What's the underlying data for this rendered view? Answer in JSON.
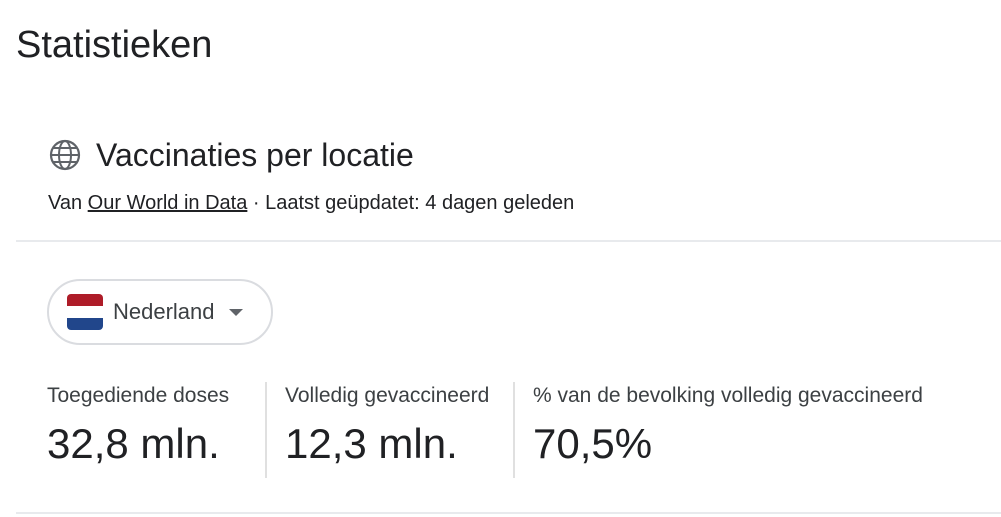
{
  "page": {
    "title": "Statistieken"
  },
  "card": {
    "title": "Vaccinaties per locatie",
    "icon": "globe-icon",
    "source": {
      "prefix": "Van ",
      "link_text": "Our World in Data",
      "suffix": " · Laatst geüpdatet: 4 dagen geleden"
    }
  },
  "location": {
    "selected": "Nederland",
    "flag_icon": "netherlands-flag-icon",
    "flag_colors": [
      "#AE1C28",
      "#FFFFFF",
      "#21468B"
    ]
  },
  "stats": [
    {
      "label": "Toegediende doses",
      "value": "32,8 mln."
    },
    {
      "label": "Volledig gevaccineerd",
      "value": "12,3 mln."
    },
    {
      "label": "% van de bevolking volledig gevaccineerd",
      "value": "70,5%"
    }
  ]
}
